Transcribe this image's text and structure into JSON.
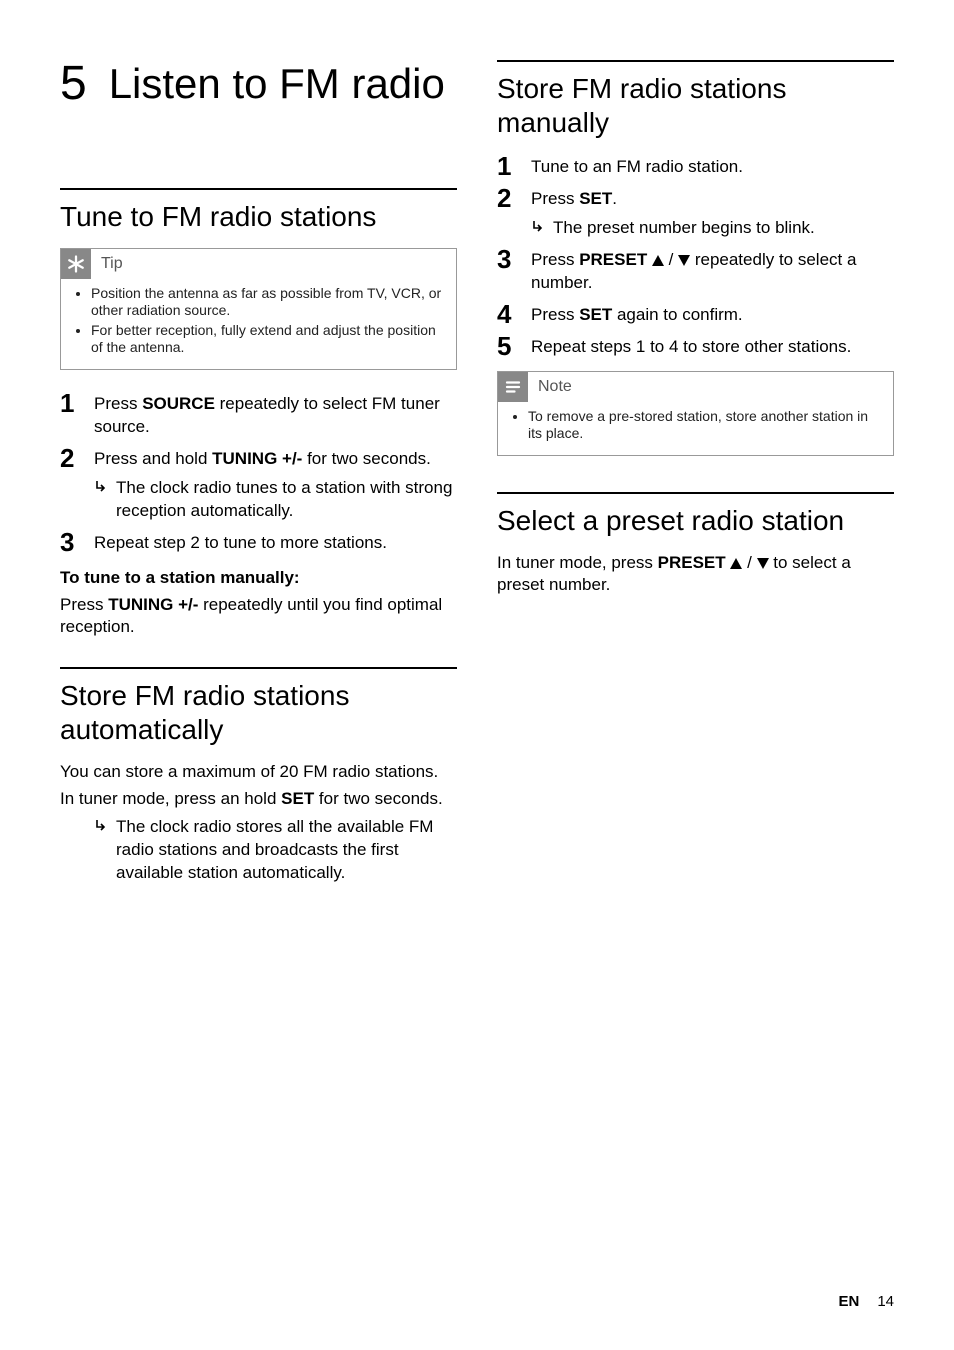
{
  "chapter": {
    "number": "5",
    "title": "Listen to FM radio"
  },
  "left": {
    "s1": {
      "title": "Tune to FM radio stations",
      "tip": {
        "label": "Tip",
        "items": [
          "Position the antenna as far as possible from TV, VCR, or other radiation source.",
          "For better reception, fully extend and adjust the position of the antenna."
        ]
      },
      "steps": {
        "n1": "1",
        "t1a": "Press ",
        "t1b": "SOURCE",
        "t1c": " repeatedly to select FM tuner source.",
        "n2": "2",
        "t2a": "Press and hold ",
        "t2b": "TUNING +/-",
        "t2c": " for two seconds.",
        "t2sub": "The clock radio tunes to a station with strong reception automatically.",
        "n3": "3",
        "t3": "Repeat step 2 to tune to more stations."
      },
      "manual_h": "To tune to a station manually:",
      "manual_a": "Press ",
      "manual_b": "TUNING +/-",
      "manual_c": " repeatedly until you find optimal reception."
    },
    "s2": {
      "title": "Store FM radio stations automatically",
      "p1": "You can store a maximum of 20 FM radio stations.",
      "p2a": "In tuner mode, press an hold ",
      "p2b": "SET",
      "p2c": " for two seconds.",
      "sub": "The clock radio stores all the available FM radio stations and broadcasts the first available station automatically."
    }
  },
  "right": {
    "s1": {
      "title": "Store FM radio stations manually",
      "steps": {
        "n1": "1",
        "t1": "Tune to an FM radio station.",
        "n2": "2",
        "t2a": "Press ",
        "t2b": "SET",
        "t2c": ".",
        "t2sub": "The preset number begins to blink.",
        "n3": "3",
        "t3a": "Press ",
        "t3b": "PRESET ",
        "t3c": " / ",
        "t3d": " repeatedly to select a number.",
        "n4": "4",
        "t4a": "Press ",
        "t4b": "SET",
        "t4c": " again to confirm.",
        "n5": "5",
        "t5": "Repeat steps 1 to 4 to store other stations."
      },
      "note": {
        "label": "Note",
        "items": [
          "To remove a pre-stored station, store another station in its place."
        ]
      }
    },
    "s2": {
      "title": "Select a preset radio station",
      "p1a": "In tuner mode, press ",
      "p1b": "PRESET ",
      "p1c": " / ",
      "p1d": " to select a preset number."
    }
  },
  "footer": {
    "lang": "EN",
    "page": "14"
  }
}
